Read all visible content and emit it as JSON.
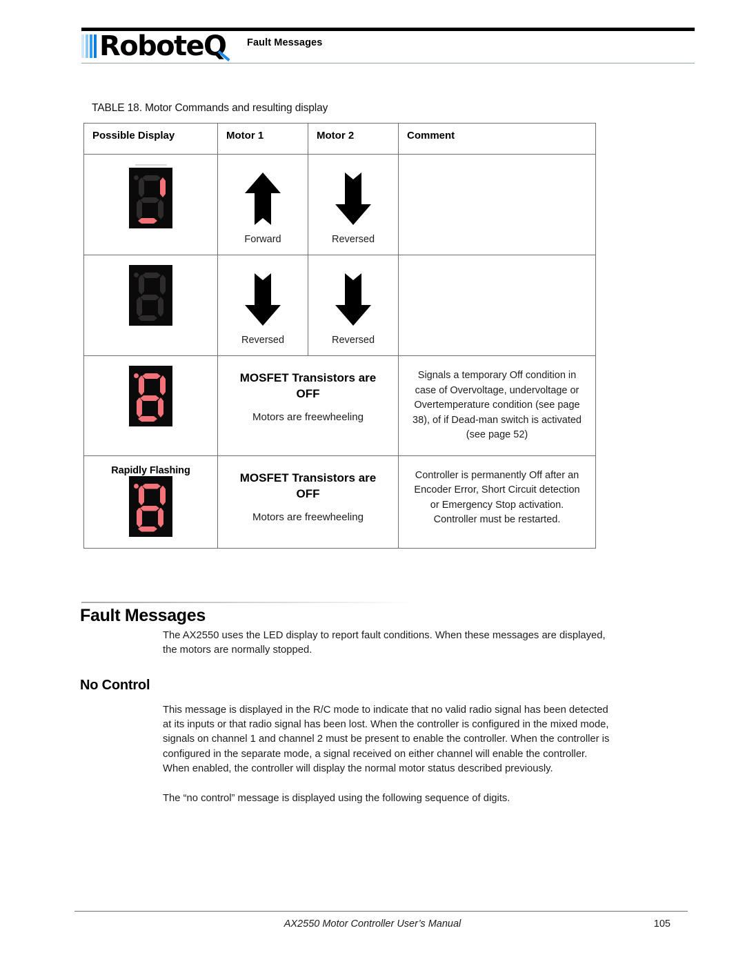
{
  "header": {
    "logo_text": "RoboteQ",
    "title": "Fault Messages"
  },
  "table": {
    "caption": "TABLE 18. Motor Commands and resulting display",
    "columns": [
      "Possible Display",
      "Motor 1",
      "Motor 2",
      "Comment"
    ],
    "rows": [
      {
        "display": {
          "flash_label": "",
          "dot": false,
          "segments": {
            "a": false,
            "b": true,
            "c": false,
            "d": true,
            "e": false,
            "f": false,
            "g": false
          }
        },
        "motor1": {
          "direction": "up",
          "caption": "Forward"
        },
        "motor2": {
          "direction": "down",
          "caption": "Reversed"
        },
        "comment_title": "",
        "comment_sub": "",
        "comment": ""
      },
      {
        "display": {
          "flash_label": "",
          "dot": false,
          "segments": {
            "a": false,
            "b": false,
            "c": false,
            "d": false,
            "e": false,
            "f": false,
            "g": false
          }
        },
        "motor1": {
          "direction": "down",
          "caption": "Reversed"
        },
        "motor2": {
          "direction": "down",
          "caption": "Reversed"
        },
        "comment_title": "",
        "comment_sub": "",
        "comment": ""
      },
      {
        "display": {
          "flash_label": "",
          "dot": true,
          "segments": {
            "a": true,
            "b": true,
            "c": true,
            "d": true,
            "e": true,
            "f": true,
            "g": true
          }
        },
        "motor1": {
          "direction": "none",
          "caption": ""
        },
        "motor2": {
          "direction": "none",
          "caption": ""
        },
        "comment_title": "MOSFET Transistors are OFF",
        "comment_sub": "Motors are freewheeling",
        "comment": "Signals a temporary Off condition in case of Overvoltage, undervoltage or Overtemperature condition (see page 38), of if Dead-man switch is activated (see page 52)"
      },
      {
        "display": {
          "flash_label": "Rapidly Flashing",
          "dot": true,
          "segments": {
            "a": true,
            "b": true,
            "c": true,
            "d": true,
            "e": true,
            "f": true,
            "g": true
          }
        },
        "motor1": {
          "direction": "none",
          "caption": ""
        },
        "motor2": {
          "direction": "none",
          "caption": ""
        },
        "comment_title": "MOSFET Transistors are OFF",
        "comment_sub": "Motors are freewheeling",
        "comment": "Controller is permanently Off after an Encoder Error, Short Circuit detection or Emergency Stop activation. Controller must be restarted."
      }
    ]
  },
  "sections": {
    "fault_heading": "Fault Messages",
    "fault_paragraph": "The AX2550 uses the LED display to report fault conditions. When these messages are displayed, the motors are normally stopped.",
    "nocontrol_heading": "No Control",
    "nocontrol_paragraph": "This message is displayed in the R/C mode to indicate that no valid radio signal has been detected at its inputs or that radio signal has been lost. When the controller is configured in the mixed mode, signals on channel 1 and channel 2 must be present to enable the controller. When the controller is configured in the separate mode, a signal received on either channel will enable the controller. When enabled, the controller will display the normal motor status described previously.",
    "sequence_paragraph": "The “no control” message is displayed using the following sequence of digits."
  },
  "footer": {
    "title": "AX2550 Motor Controller User’s Manual",
    "page": "105"
  },
  "colors": {
    "segment_on": "#f4737a",
    "segment_off": "#2e2b2c",
    "panel": "#0a0a0a",
    "logo_blue": "#0d7ddb"
  }
}
